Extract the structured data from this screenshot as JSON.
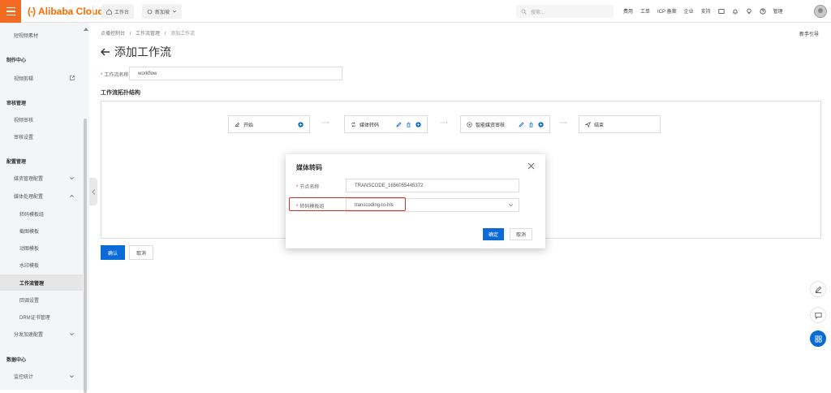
{
  "topbar": {
    "logo_text": "Alibaba Cloud",
    "workbench": "工作台",
    "region": "新加坡",
    "search_placeholder": "搜索...",
    "links": [
      "费用",
      "工单",
      "ICP 备案",
      "企业",
      "支持"
    ],
    "user": "管理"
  },
  "sidebar": {
    "items": [
      {
        "label": "短视频素材",
        "type": "sub1",
        "chevron": ""
      },
      {
        "label": "制作中心",
        "type": "group",
        "chevron": ""
      },
      {
        "label": "视频剪辑",
        "type": "sub1",
        "chevron": "",
        "external": true
      },
      {
        "label": "审核管理",
        "type": "group",
        "chevron": ""
      },
      {
        "label": "视频审核",
        "type": "sub1",
        "chevron": ""
      },
      {
        "label": "审核设置",
        "type": "sub1",
        "chevron": ""
      },
      {
        "label": "配置管理",
        "type": "group",
        "chevron": ""
      },
      {
        "label": "媒资管理配置",
        "type": "sub1",
        "chevron": "down"
      },
      {
        "label": "媒体处理配置",
        "type": "sub1",
        "chevron": "up"
      },
      {
        "label": "转码模板组",
        "type": "sub2",
        "chevron": ""
      },
      {
        "label": "截图模板",
        "type": "sub2",
        "chevron": ""
      },
      {
        "label": "动图模板",
        "type": "sub2",
        "chevron": ""
      },
      {
        "label": "水印模板",
        "type": "sub2",
        "chevron": ""
      },
      {
        "label": "工作流管理",
        "type": "sub2",
        "chevron": "",
        "active": true
      },
      {
        "label": "回调设置",
        "type": "sub2",
        "chevron": ""
      },
      {
        "label": "DRM证书管理",
        "type": "sub2",
        "chevron": ""
      },
      {
        "label": "分发加速配置",
        "type": "sub1",
        "chevron": "down"
      },
      {
        "label": "数据中心",
        "type": "group",
        "chevron": ""
      },
      {
        "label": "监控统计",
        "type": "sub1",
        "chevron": "down"
      }
    ]
  },
  "breadcrumb": {
    "items": [
      "点播控制台",
      "工作流管理",
      "添加工作流"
    ],
    "separator": "/"
  },
  "guide_link": "新手引导",
  "page": {
    "title": "添加工作流",
    "name_label": "工作流名称",
    "name_value": "workflow",
    "topology_title": "工作流拓扑结构"
  },
  "nodes": {
    "start": "开始",
    "transcode": "媒体转码",
    "audit": "智能媒资审核",
    "end": "结束"
  },
  "actions": {
    "confirm": "确认",
    "cancel": "取消"
  },
  "modal": {
    "title": "媒体转码",
    "node_name_label": "节点名称",
    "node_name_value": "TRANSCODE_1656055445372",
    "template_label": "转码模板组",
    "template_value": "transcoding-to-hls",
    "ok": "确定",
    "cancel": "取消"
  },
  "colors": {
    "brand": "#ff6a00",
    "primary": "#0b6bd6",
    "highlight": "#d93026"
  }
}
